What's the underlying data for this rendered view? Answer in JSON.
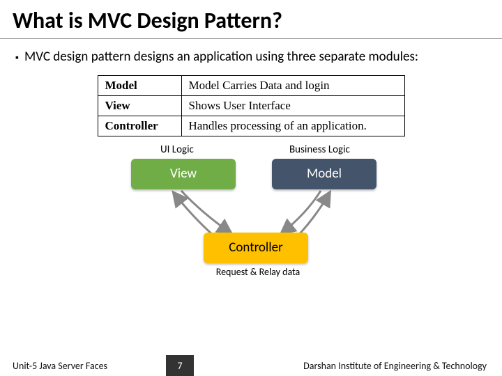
{
  "title": "What is MVC Design Pattern?",
  "bullet": "MVC design pattern designs an application using three separate modules:",
  "table": {
    "rows": [
      {
        "name": "Model",
        "desc": "Model Carries Data and login"
      },
      {
        "name": "View",
        "desc": "Shows User Interface"
      },
      {
        "name": "Controller",
        "desc": "Handles processing of an application."
      }
    ]
  },
  "diagram": {
    "ui_label": "UI Logic",
    "biz_label": "Business Logic",
    "view": "View",
    "model": "Model",
    "controller": "Controller",
    "ctrl_caption": "Request & Relay data"
  },
  "footer": {
    "left": "Unit-5 Java Server Faces",
    "page": "7",
    "right": "Darshan Institute of Engineering & Technology"
  }
}
